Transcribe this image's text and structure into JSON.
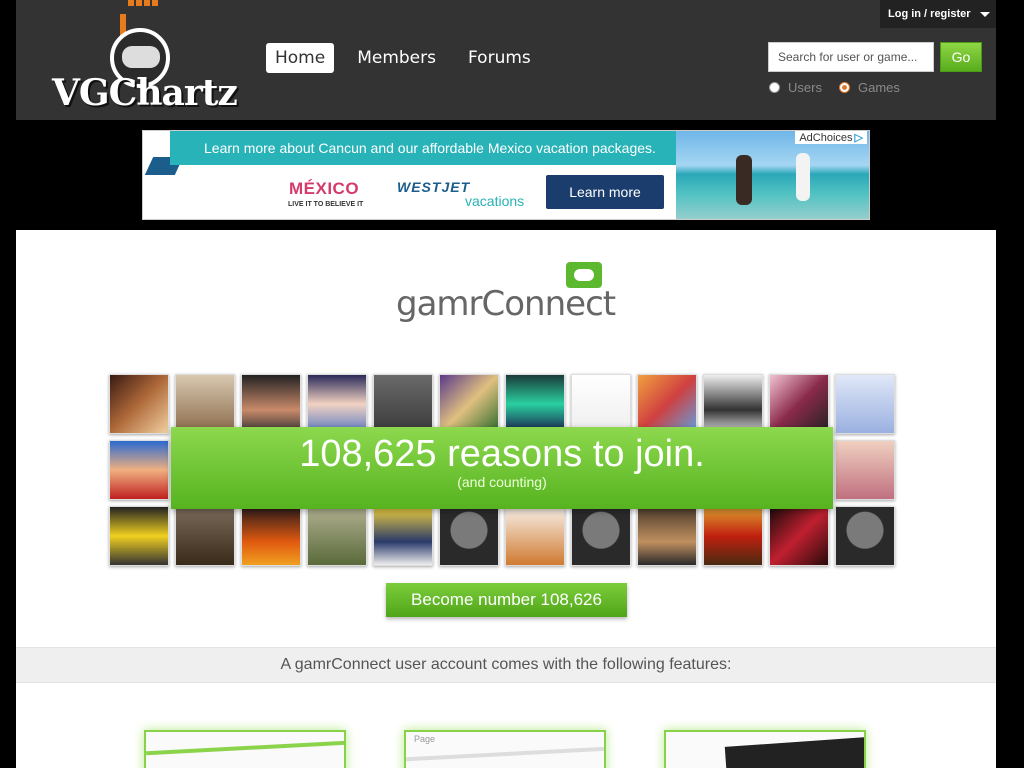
{
  "header": {
    "logo_text": "VGChartz",
    "nav": [
      "Home",
      "Members",
      "Forums"
    ],
    "active_nav": "Home",
    "login_label": "Log in / register",
    "search": {
      "placeholder": "Search for user or game...",
      "go_label": "Go"
    },
    "search_scope": [
      {
        "label": "Users",
        "checked": false
      },
      {
        "label": "Games",
        "checked": true
      }
    ]
  },
  "ad": {
    "headline": "Learn more about Cancun and our affordable Mexico vacation packages.",
    "brand1": "MÉXICO",
    "brand1_tagline": "LIVE IT TO BELIEVE IT",
    "brand2": "WESTJET",
    "brand2_sub": "vacations",
    "cta": "Learn more",
    "adchoices": "AdChoices"
  },
  "main": {
    "gamr_logo": "gamrConnect",
    "headline": "108,625 reasons to join.",
    "subheadline": "(and counting)",
    "become_button": "Become number 108,626",
    "features_text": "A gamrConnect user account comes with the following features:",
    "feature_card_label": "Page"
  },
  "colors": {
    "header_bg": "#333333",
    "accent_green": "#5cb82e",
    "ad_teal": "#27b3b7"
  }
}
